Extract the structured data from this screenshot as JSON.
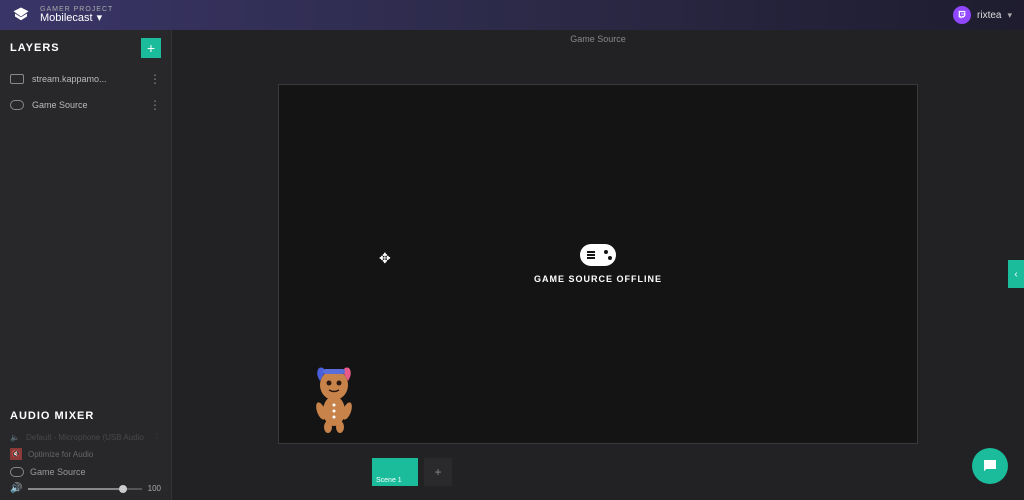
{
  "topbar": {
    "project_label": "GAMER PROJECT",
    "project_name": "Mobilecast",
    "username": "rixtea"
  },
  "sidebar": {
    "layers_title": "LAYERS",
    "add_label": "+",
    "layers": [
      {
        "label": "stream.kappamo..."
      },
      {
        "label": "Game Source"
      }
    ],
    "audio_title": "AUDIO MIXER",
    "audio_items": [
      {
        "label": "Default - Microphone (USB Audio"
      },
      {
        "label": "Optimize for Audio"
      }
    ],
    "audio_source": "Game Source",
    "volume_value": "100"
  },
  "canvas": {
    "label": "Game Source",
    "offline_text": "GAME SOURCE OFFLINE"
  },
  "scenes": {
    "tab1": "Scene 1",
    "add": "+"
  }
}
